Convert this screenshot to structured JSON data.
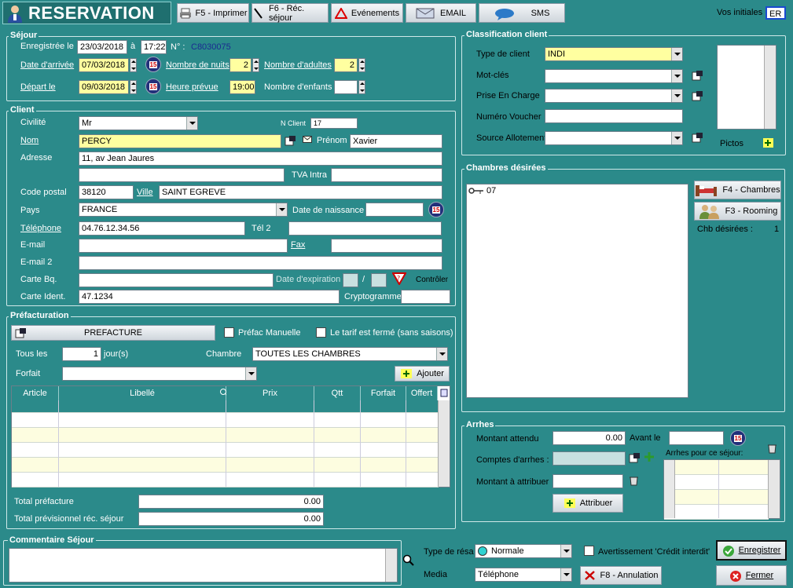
{
  "header": {
    "title": "RESERVATION",
    "initials_label": "Vos initiales",
    "initials": "ER"
  },
  "toolbar": {
    "print": "F5 - Imprimer",
    "stay": "F6 - Réc. séjour",
    "events": "Evénements",
    "email": "EMAIL",
    "sms": "SMS"
  },
  "sejour": {
    "title": "Séjour",
    "registered_label": "Enregistrée le",
    "registered_date": "23/03/2018",
    "a": "à",
    "registered_time": "17:22",
    "num_label": "N° :",
    "num": "C8030075",
    "arrival_label": "Date d'arrivée",
    "arrival": "07/03/2018",
    "nights_label": "Nombre de nuits",
    "nights": "2",
    "adults_label": "Nombre d'adultes",
    "adults": "2",
    "departure_label": "Départ le",
    "departure": "09/03/2018",
    "time_label": "Heure prévue",
    "time": "19:00",
    "children_label": "Nombre d'enfants",
    "children": ""
  },
  "client": {
    "title": "Client",
    "civility_label": "Civilité",
    "civility": "Mr",
    "nclient_label": "N Client",
    "nclient": "17",
    "name_label": "Nom",
    "name": "PERCY",
    "firstname_label": "Prénom",
    "firstname": "Xavier",
    "address_label": "Adresse",
    "address1": "11, av Jean Jaures",
    "address2": "",
    "tva_label": "TVA Intra",
    "tva": "",
    "postal_label": "Code postal",
    "postal": "38120",
    "city_label": "Ville",
    "city": "SAINT EGREVE",
    "country_label": "Pays",
    "country": "FRANCE",
    "birth_label": "Date de naissance",
    "birth": "",
    "phone_label": "Téléphone",
    "phone": "04.76.12.34.56",
    "phone2_label": "Tél 2",
    "phone2": "",
    "email_label": "E-mail",
    "email": "",
    "fax_label": "Fax",
    "fax": "",
    "email2_label": "E-mail 2",
    "email2": "",
    "card_label": "Carte Bq.",
    "card": "",
    "exp_label": "Date d'expiration",
    "exp_sep": "/",
    "control_label": "Contrôler",
    "id_label": "Carte Ident.",
    "id": "47.1234",
    "crypto_label": "Cryptogramme",
    "crypto": ""
  },
  "prefact": {
    "title": "Préfacturation",
    "button": "PREFACTURE",
    "manual": "Préfac Manuelle",
    "fixed": "Le tarif est fermé (sans saisons)",
    "every_label": "Tous les",
    "every": "1",
    "days": "jour(s)",
    "room_label": "Chambre",
    "room": "TOUTES LES CHAMBRES",
    "package_label": "Forfait",
    "package": "",
    "add": "Ajouter",
    "columns": [
      "Article",
      "Libellé",
      "Prix",
      "Qtt",
      "Forfait",
      "Offert"
    ],
    "total_label": "Total préfacture",
    "total": "0.00",
    "forecast_label": "Total prévisionnel réc. séjour",
    "forecast": "0.00"
  },
  "classif": {
    "title": "Classification client",
    "type_label": "Type de client",
    "type": "INDI",
    "keywords_label": "Mot-clés",
    "keywords": "",
    "support_label": "Prise En Charge",
    "support": "",
    "voucher_label": "Numéro Voucher",
    "voucher": "",
    "allot_label": "Source Allotement",
    "allot": "",
    "pictos": "Pictos"
  },
  "rooms": {
    "title": "Chambres désirées",
    "room": "07",
    "btn_rooms": "F4 - Chambres",
    "btn_rooming": "F3 - Rooming",
    "count_label": "Chb désirées :",
    "count": "1"
  },
  "arrhes": {
    "title": "Arrhes",
    "expected_label": "Montant attendu",
    "expected": "0.00",
    "before_label": "Avant le",
    "before": "",
    "accounts_label": "Comptes d'arrhes :",
    "accounts": "",
    "stay_label": "Arrhes pour ce séjour:",
    "assign_label": "Montant à attribuer",
    "assign": "",
    "assign_btn": "Attribuer"
  },
  "comment": {
    "title": "Commentaire Séjour",
    "text": ""
  },
  "footer": {
    "type_label": "Type de résa",
    "type": "Normale",
    "credit_label": "Avertissement 'Crédit interdit'",
    "media_label": "Media",
    "media": "Téléphone",
    "cancel": "F8 - Annulation",
    "save": "Enregistrer",
    "close": "Fermer"
  },
  "colors": {
    "background": "#2b8a8a",
    "yellow_field": "#ffffa0",
    "grid_row_alt": "#fdfde0"
  }
}
